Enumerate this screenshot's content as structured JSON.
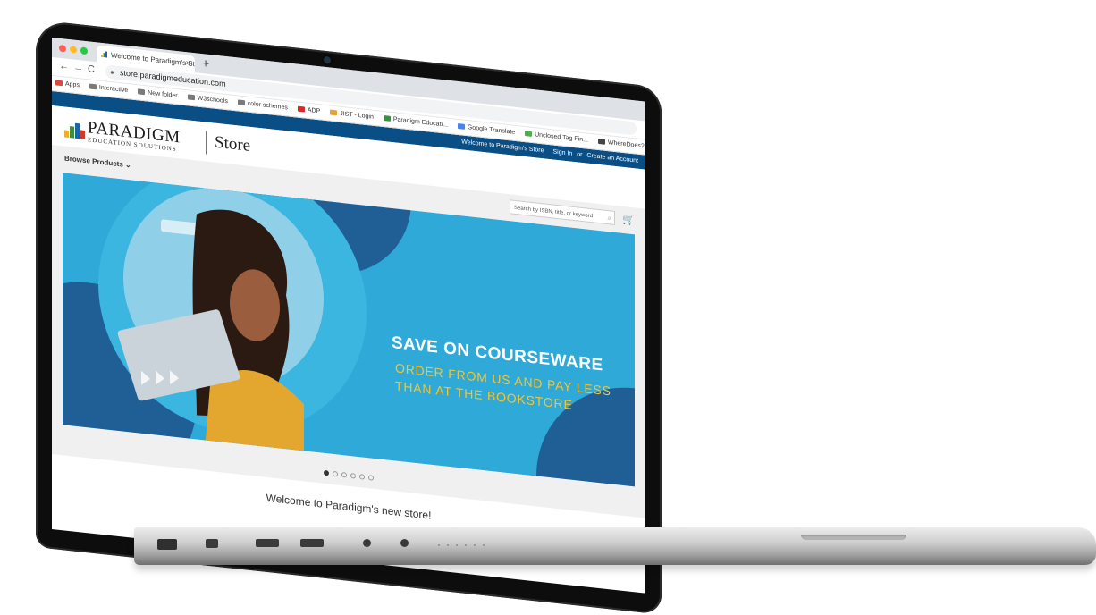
{
  "browser": {
    "tab_title": "Welcome to Paradigm's Store",
    "tab_close": "×",
    "new_tab": "+",
    "url": "store.paradigmeducation.com",
    "bookmarks": [
      "Apps",
      "Interactive",
      "New folder",
      "W3schools",
      "color schemes",
      "ADP",
      "JIST - Login",
      "Paradigm Educati...",
      "Google Translate",
      "Unclosed Tag Fin...",
      "WhereDoes? - A t..."
    ]
  },
  "site": {
    "topbar": {
      "welcome": "Welcome to Paradigm's Store",
      "sign_in": "Sign In",
      "or": "or",
      "create_account": "Create an Account"
    },
    "logo": {
      "name": "PARADIGM",
      "sub": "EDUCATION SOLUTIONS",
      "store": "Store"
    },
    "nav": {
      "browse": "Browse Products",
      "search_placeholder": "Search by ISBN, title, or keyword"
    },
    "hero": {
      "title": "SAVE ON COURSEWARE",
      "sub": "ORDER FROM US AND PAY LESS THAN AT THE BOOKSTORE"
    },
    "welcome": "Welcome to Paradigm's new store!"
  },
  "carousel": {
    "count": 6,
    "active": 0
  },
  "icons": {
    "cart": "cart-icon",
    "search": "search-icon",
    "lock": "lock-icon",
    "webcam": "webcam-icon"
  },
  "colors": {
    "brand_blue": "#0a4e86",
    "hero_blue": "#2ea9d8",
    "hero_yellow": "#f5c531"
  }
}
